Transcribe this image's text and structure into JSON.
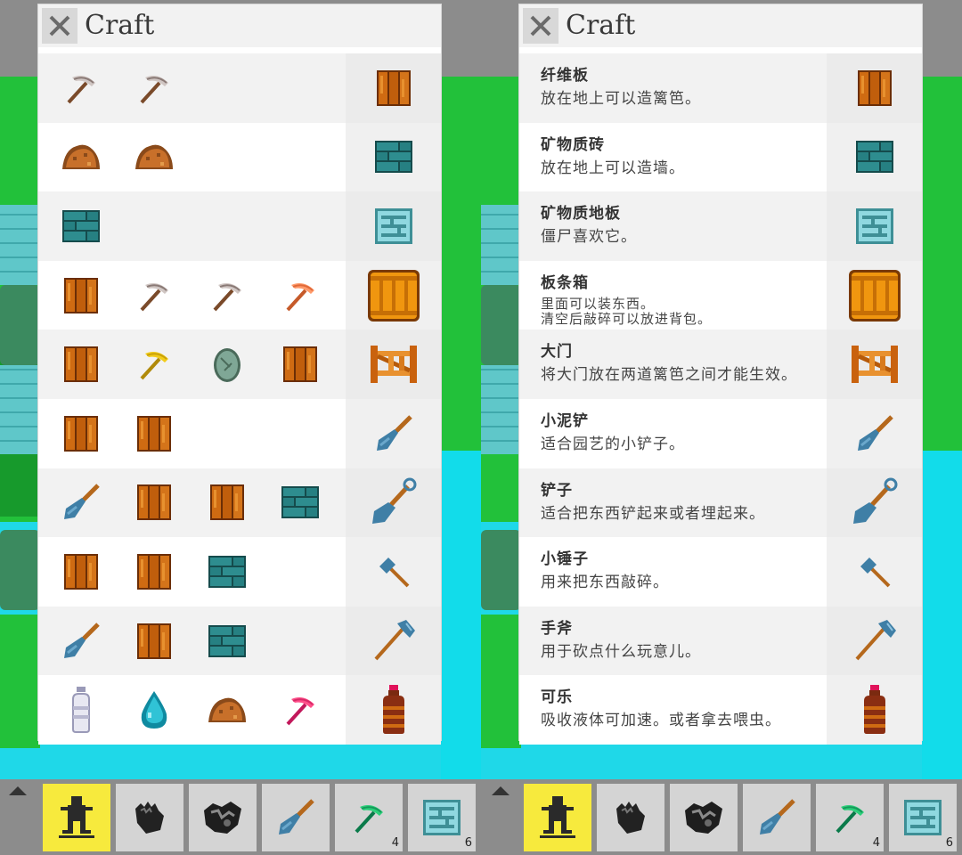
{
  "left_panel": {
    "title": "Craft",
    "recipes": [
      {
        "inputs": [
          "pickaxe-stone-icon",
          "pickaxe-stone-icon"
        ],
        "result": "wood-plank-icon"
      },
      {
        "inputs": [
          "dirt-pile-icon",
          "dirt-pile-icon"
        ],
        "result": "mineral-brick-icon"
      },
      {
        "inputs": [
          "mineral-brick-icon"
        ],
        "result": "mineral-floor-icon"
      },
      {
        "inputs": [
          "wood-plank-icon",
          "pickaxe-stone-icon",
          "pickaxe-stone-icon",
          "pickaxe-orange-icon"
        ],
        "result": "crate-icon"
      },
      {
        "inputs": [
          "wood-plank-icon",
          "pickaxe-gold-icon",
          "stone-egg-icon",
          "wood-plank-icon"
        ],
        "result": "gate-icon"
      },
      {
        "inputs": [
          "wood-plank-icon",
          "wood-plank-icon"
        ],
        "result": "trowel-icon"
      },
      {
        "inputs": [
          "trowel-icon",
          "wood-plank-icon",
          "wood-plank-icon",
          "mineral-brick-icon"
        ],
        "result": "shovel-icon"
      },
      {
        "inputs": [
          "wood-plank-icon",
          "wood-plank-icon",
          "mineral-brick-icon"
        ],
        "result": "hammer-icon"
      },
      {
        "inputs": [
          "trowel-icon",
          "wood-plank-icon",
          "mineral-brick-icon"
        ],
        "result": "axe-icon"
      },
      {
        "inputs": [
          "water-bottle-icon",
          "water-drop-icon",
          "dirt-pile-icon",
          "pickaxe-pink-icon"
        ],
        "result": "cola-bottle-icon"
      }
    ]
  },
  "right_panel": {
    "title": "Craft",
    "items": [
      {
        "name": "纤维板",
        "desc": "放在地上可以造篱笆。",
        "icon": "wood-plank-icon"
      },
      {
        "name": "矿物质砖",
        "desc": "放在地上可以造墙。",
        "icon": "mineral-brick-icon"
      },
      {
        "name": "矿物质地板",
        "desc": "僵尸喜欢它。",
        "icon": "mineral-floor-icon"
      },
      {
        "name": "板条箱",
        "desc": "里面可以装东西。\n清空后敲碎可以放进背包。",
        "icon": "crate-icon"
      },
      {
        "name": "大门",
        "desc": "将大门放在两道篱笆之间才能生效。",
        "icon": "gate-icon"
      },
      {
        "name": "小泥铲",
        "desc": "适合园艺的小铲子。",
        "icon": "trowel-icon"
      },
      {
        "name": "铲子",
        "desc": "适合把东西铲起来或者埋起来。",
        "icon": "shovel-icon"
      },
      {
        "name": "小锤子",
        "desc": "用来把东西敲碎。",
        "icon": "hammer-icon"
      },
      {
        "name": "手斧",
        "desc": "用于砍点什么玩意儿。",
        "icon": "axe-icon"
      },
      {
        "name": "可乐",
        "desc": "吸收液体可加速。或者拿去喂虫。",
        "icon": "cola-bottle-icon"
      }
    ]
  },
  "toolbar": {
    "slots": [
      {
        "icon": "character-icon",
        "selected": true,
        "count": ""
      },
      {
        "icon": "glove-icon",
        "selected": false,
        "count": ""
      },
      {
        "icon": "armor-icon",
        "selected": false,
        "count": ""
      },
      {
        "icon": "trowel-icon",
        "selected": false,
        "count": ""
      },
      {
        "icon": "pickaxe-green-icon",
        "selected": false,
        "count": "4"
      },
      {
        "icon": "mineral-floor-icon",
        "selected": false,
        "count": "6"
      }
    ]
  },
  "colors": {
    "wood": "#c9620e",
    "brick_teal": "#2e8d8f",
    "floor_light": "#8fd8e0",
    "selected_slot": "#f7ea3d",
    "water": "#12dcea",
    "grass": "#22c13a"
  }
}
